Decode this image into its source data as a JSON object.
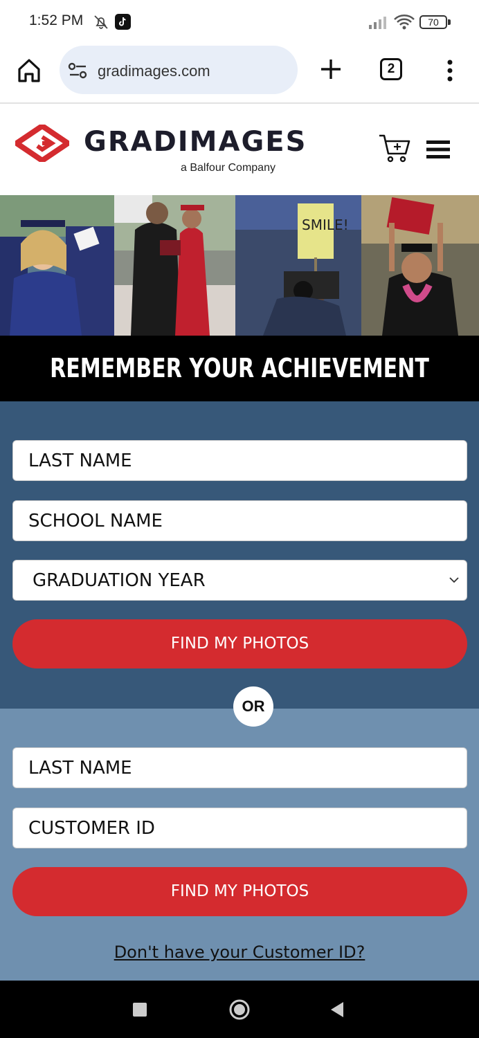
{
  "status": {
    "time": "1:52 PM",
    "battery": "70",
    "icons": [
      "bell-off-icon",
      "tiktok-icon",
      "signal-icon",
      "wifi-icon",
      "battery-icon"
    ]
  },
  "browser": {
    "url": "gradimages.com",
    "tab_count": "2",
    "icons": [
      "home-icon",
      "site-settings-icon",
      "plus-icon",
      "more-vert-icon"
    ]
  },
  "header": {
    "logo_text": "GRADIMAGES",
    "logo_sub": "a Balfour Company",
    "icons": [
      "cart-icon",
      "hamburger-menu-icon"
    ]
  },
  "hero": {
    "sign_text": "SMILE!"
  },
  "banner": {
    "title": "REMEMBER YOUR ACHIEVEMENT"
  },
  "search_by_school": {
    "last_name_placeholder": "LAST NAME",
    "school_name_placeholder": "SCHOOL NAME",
    "graduation_year_placeholder": "GRADUATION YEAR",
    "button_label": "FIND MY PHOTOS"
  },
  "divider": {
    "label": "OR"
  },
  "search_by_id": {
    "last_name_placeholder": "LAST NAME",
    "customer_id_placeholder": "CUSTOMER ID",
    "button_label": "FIND MY PHOTOS",
    "help_link": "Don't have your Customer ID?"
  },
  "colors": {
    "brand_red": "#d42b2f",
    "top_form_bg": "#375879",
    "bottom_form_bg": "#6f90af",
    "banner_bg": "#000000"
  }
}
